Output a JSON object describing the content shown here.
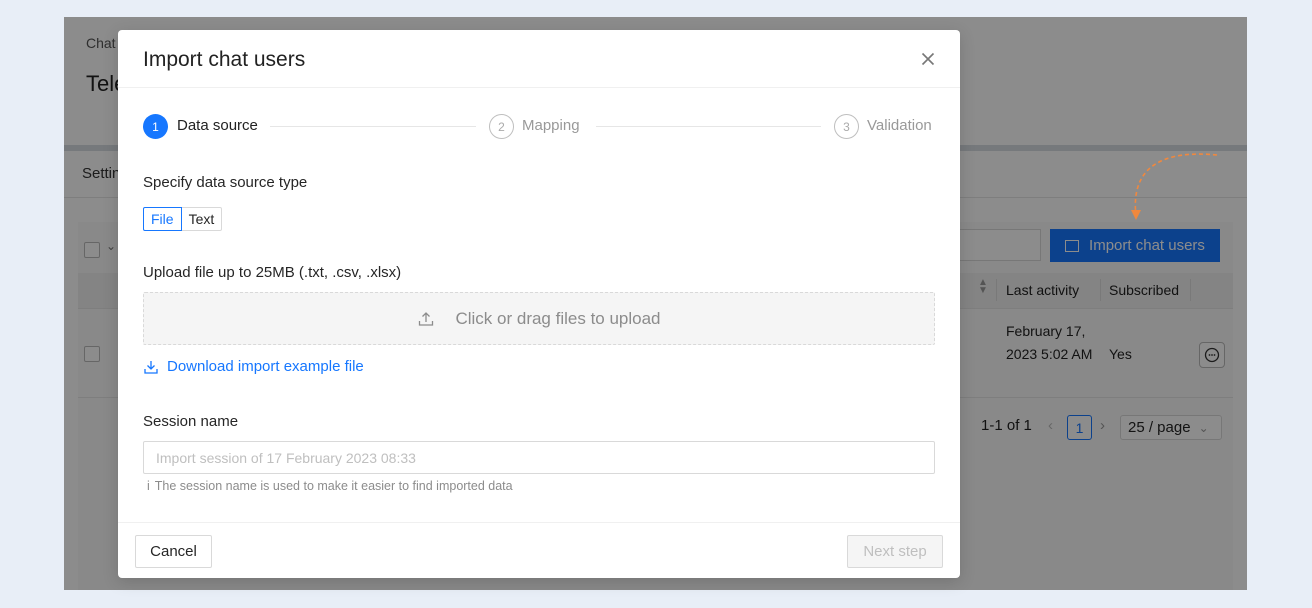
{
  "background": {
    "breadcrumb": "Chat",
    "page_title": "Tele",
    "settings_tab": "Settin",
    "import_button_label": "Import chat users",
    "columns": [
      "Last activity",
      "Subscribed"
    ],
    "row": {
      "last_activity": "February 17, 2023 5:02 AM",
      "subscribed": "Yes"
    },
    "pagination": {
      "range": "1-1 of 1",
      "current_page": "1",
      "page_size": "25 / page"
    }
  },
  "modal": {
    "title": "Import chat users",
    "steps": [
      {
        "number": "1",
        "label": "Data source",
        "status": "active"
      },
      {
        "number": "2",
        "label": "Mapping",
        "status": "wait"
      },
      {
        "number": "3",
        "label": "Validation",
        "status": "wait"
      }
    ],
    "source_type_label": "Specify data source type",
    "source_type_options": [
      "File",
      "Text"
    ],
    "source_type_selected": "File",
    "upload_label": "Upload file up to 25MB (.txt, .csv, .xlsx)",
    "dropzone_text": "Click or drag files to upload",
    "download_link": "Download import example file",
    "session_name_label": "Session name",
    "session_name_value": "",
    "session_name_placeholder": "Import session of 17 February 2023 08:33",
    "session_hint": "The session name is used to make it easier to find imported data",
    "hint_icon": "i",
    "cancel_label": "Cancel",
    "next_label": "Next step"
  },
  "colors": {
    "primary": "#1677ff",
    "annotation_arrow": "#f0883e",
    "mask": "rgba(0,0,0,0.45)"
  }
}
